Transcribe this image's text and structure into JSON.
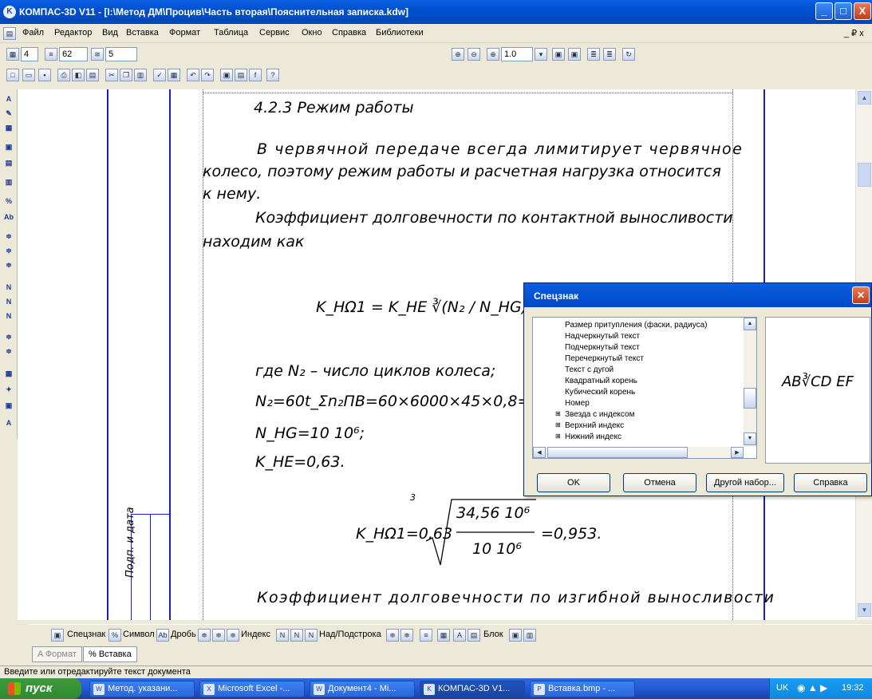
{
  "window": {
    "title": "КОМПАС-3D V11 - [I:\\Метод ДМ\\Процив\\Часть вторая\\Пояснительная записка.kdw]",
    "minimize": "_",
    "maximize": "□",
    "close": "X"
  },
  "menu": [
    "Файл",
    "Редактор",
    "Вид",
    "Вставка",
    "Формат",
    "Таблица",
    "Сервис",
    "Окно",
    "Справка",
    "Библиотеки"
  ],
  "menu_right": "_ ₽ x",
  "toolbar1": {
    "field1": "4",
    "field2": "62",
    "field3": "5",
    "zoom": "1.0"
  },
  "document": {
    "heading": "4.2.3 Режим работы",
    "para1_line1": "В червячной передаче всегда лимитирует червячное",
    "para1_line2": "колесо, поэтому режим работы и расчетная нагрузка относится",
    "para1_line3": "к нему.",
    "para2_line1": "Коэффициент долговечности по контактной выносливости",
    "para2_line2": "находим как",
    "formula1": "K_HΩ1 = K_HE ∛(N₂ / N_HG),",
    "where": "где N₂ – число циклов колеса;",
    "n2": "N₂=60t_Σn₂ПВ=60×6000×45×0,8=34,5",
    "nhg": "N_HG=10 10⁶;",
    "khe": "K_HE=0,63.",
    "formula2_left": "K_HΩ1=0,63",
    "formula2_num": "34,56 10⁶",
    "formula2_den": "10 10⁶",
    "formula2_right": "=0,953.",
    "para3": "Коэффициент долговечности по изгибной выносливости",
    "stamp": "Подп. и дата"
  },
  "dialog": {
    "title": "Спецзнак",
    "items": [
      "Размер притупления (фаски, радиуса)",
      "Надчеркнутый текст",
      "Подчеркнутый текст",
      "Перечеркнутый текст",
      "Текст с дугой",
      "Квадратный корень",
      "Кубический корень",
      "Номер",
      "Звезда с индексом",
      "Верхний индекс",
      "Нижний индекс"
    ],
    "preview": "AB∛CD EF",
    "buttons": {
      "ok": "OK",
      "cancel": "Отмена",
      "other": "Другой набор...",
      "help": "Справка"
    }
  },
  "format_toolbar": [
    "Спецзнак",
    "Символ",
    "Дробь",
    "Индекс",
    "Над/Подстрока",
    "Блок"
  ],
  "tabs": [
    "Формат",
    "Вставка"
  ],
  "status": "Введите или отредактируйте текст документа",
  "taskbar": {
    "start": "пуск",
    "tasks": [
      "Метод. указани...",
      "Microsoft Excel -...",
      "Документ4 - Mi...",
      "КОМПАС-3D V1...",
      "Вставка.bmp - ..."
    ],
    "lang": "UK",
    "clock": "19:32"
  },
  "colors": {
    "titlebar": "#0a5fe0",
    "frame": "#1b1bd0",
    "taskbar": "#245edb",
    "start": "#3c9a3c"
  }
}
